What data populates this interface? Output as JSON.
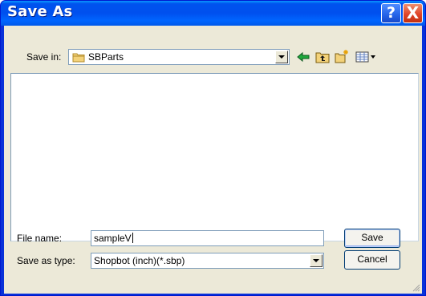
{
  "window": {
    "title": "Save As",
    "help_label": "?",
    "close_label": "X"
  },
  "save_in": {
    "label": "Save in:",
    "value": "SBParts",
    "icon": "folder-icon"
  },
  "toolbar": {
    "icons": [
      "back-arrow-icon",
      "up-one-level-icon",
      "create-new-folder-icon",
      "view-menu-icon"
    ]
  },
  "file_list": {
    "items": []
  },
  "file_name": {
    "label": "File name:",
    "value": "sampleV"
  },
  "save_as_type": {
    "label": "Save as type:",
    "value": "Shopbot (inch)(*.sbp)"
  },
  "buttons": {
    "save": "Save",
    "cancel": "Cancel"
  },
  "colors": {
    "title_bar": "#0054e3",
    "close_button": "#e0452a",
    "dialog_face": "#ece9d8",
    "back_arrow": "#1ea83c",
    "folder": "#f3d27a"
  }
}
